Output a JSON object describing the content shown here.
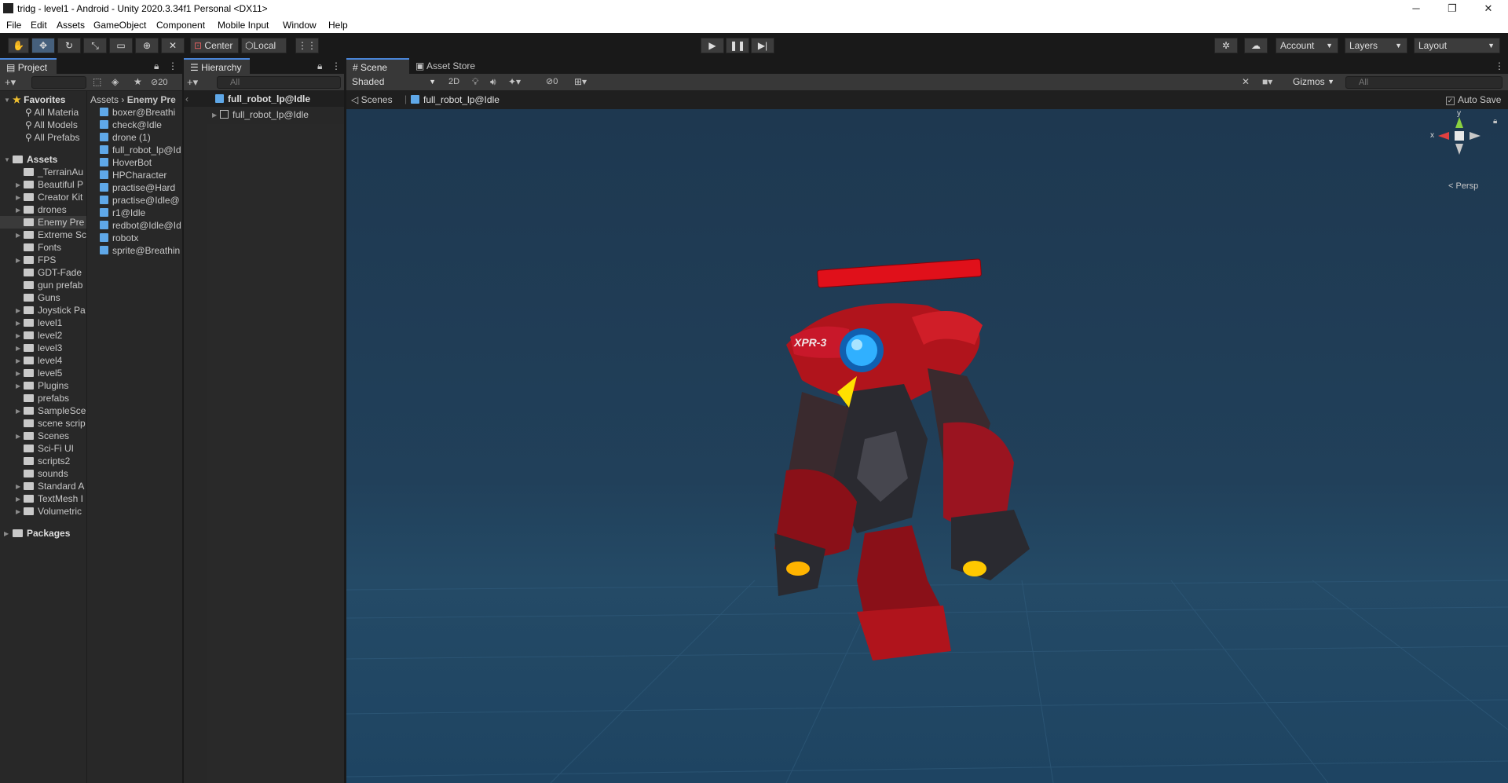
{
  "window": {
    "title": "tridg - level1 - Android - Unity 2020.3.34f1 Personal <DX11>",
    "minimize": "─",
    "restore": "❐",
    "close": "✕"
  },
  "menu": [
    "File",
    "Edit",
    "Assets",
    "GameObject",
    "Component",
    "Mobile Input",
    "Window",
    "Help"
  ],
  "toolbar": {
    "pivot": "Center",
    "space": "Local",
    "account": "Account",
    "layers": "Layers",
    "layout": "Layout"
  },
  "project": {
    "tab": "Project",
    "hidden_count": "20",
    "favorites_label": "Favorites",
    "favorites": [
      "All Materia",
      "All Models",
      "All Prefabs"
    ],
    "assets_label": "Assets",
    "folders": [
      "_TerrainAu",
      "Beautiful P",
      "Creator Kit",
      "drones",
      "Enemy Pre",
      "Extreme Sc",
      "Fonts",
      "FPS",
      "GDT-Fade",
      "gun prefab",
      "Guns",
      "Joystick Pa",
      "level1",
      "level2",
      "level3",
      "level4",
      "level5",
      "Plugins",
      "prefabs",
      "SampleSce",
      "scene scrip",
      "Scenes",
      "Sci-Fi UI",
      "scripts2",
      "sounds",
      "Standard A",
      "TextMesh I",
      "Volumetric"
    ],
    "packages_label": "Packages",
    "breadcrumb_root": "Assets",
    "breadcrumb_current": "Enemy Pre",
    "files": [
      "boxer@Breathi",
      "check@Idle",
      "drone (1)",
      "full_robot_lp@Id",
      "HoverBot",
      "HPCharacter",
      "practise@Hard",
      "practise@Idle@",
      "r1@Idle",
      "redbot@Idle@Id",
      "robotx",
      "sprite@Breathin"
    ]
  },
  "hierarchy": {
    "tab": "Hierarchy",
    "search_placeholder": "All",
    "root": "full_robot_lp@Idle",
    "child": "full_robot_lp@Idle"
  },
  "scene": {
    "tab_scene": "Scene",
    "tab_asset_store": "Asset Store",
    "shading": "Shaded",
    "mode_2d": "2D",
    "hidden_count": "0",
    "gizmos": "Gizmos",
    "search_placeholder": "All",
    "breadcrumb_scenes": "Scenes",
    "breadcrumb_object": "full_robot_lp@Idle",
    "auto_save": "Auto Save",
    "persp": "< Persp",
    "axis_x": "x",
    "axis_y": "y",
    "robot_decal": "XPR-3"
  }
}
